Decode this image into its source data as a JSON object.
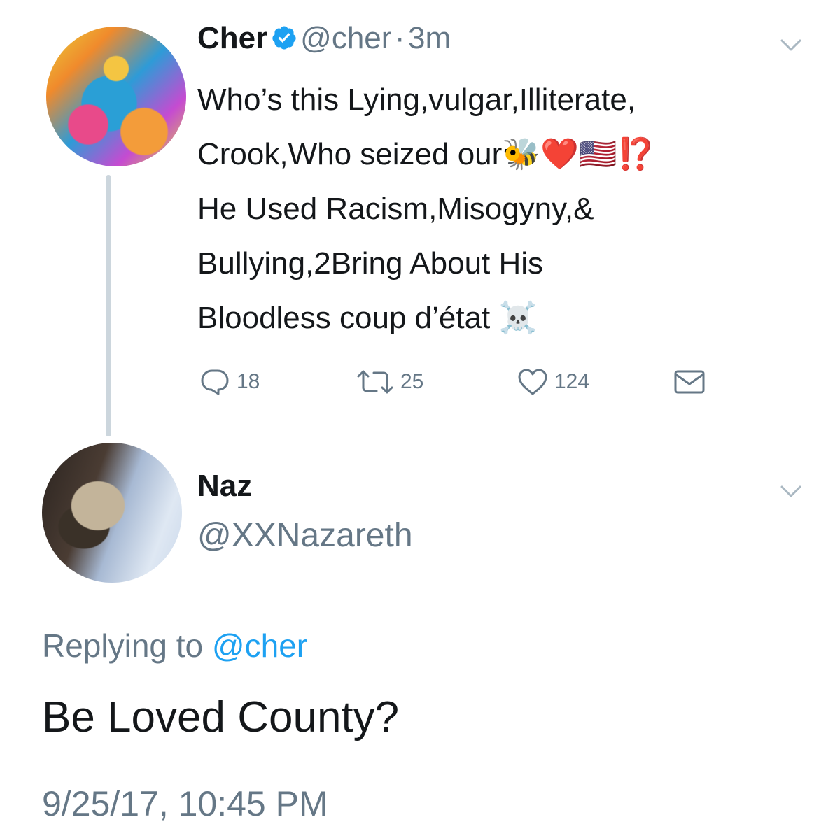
{
  "tweet": {
    "author_name": "Cher",
    "handle": "@cher",
    "separator": "·",
    "time_ago": "3m",
    "lines": [
      "Who’s this Lying,vulgar,Illiterate,",
      "Crook,Who seized our🐝❤️🇺🇸⁉️",
      "He Used Racism,Misogyny,&",
      "Bullying,2Bring About His",
      "Bloodless coup d’état ☠️"
    ],
    "actions": {
      "replies": "18",
      "retweets": "25",
      "likes": "124"
    },
    "icons": {
      "verified": "verified-badge-icon",
      "menu": "chevron-down-icon",
      "reply": "reply-icon",
      "retweet": "retweet-icon",
      "like": "heart-icon",
      "dm": "envelope-icon"
    }
  },
  "reply": {
    "author_name": "Naz",
    "handle": "@XXNazareth",
    "replying_prefix": "Replying to",
    "replying_to": "@cher",
    "text": "Be Loved County?",
    "timestamp": "9/25/17, 10:45 PM"
  },
  "colors": {
    "text": "#14171a",
    "secondary": "#657786",
    "link": "#1da1f2",
    "thread_line": "#ccd6dd"
  }
}
